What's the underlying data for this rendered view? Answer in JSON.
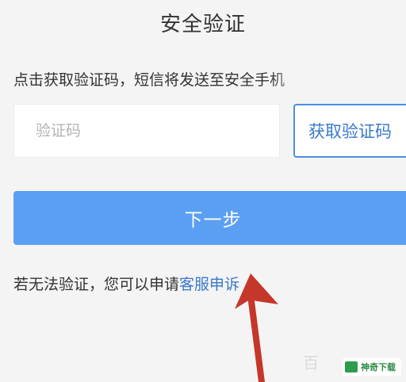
{
  "header": {
    "title": "安全验证"
  },
  "hint": {
    "text": "点击获取验证码，短信将发送至安全手机"
  },
  "form": {
    "code_placeholder": "验证码",
    "get_code_label": "获取验证码",
    "next_label": "下一步"
  },
  "footer": {
    "prefix": "若无法验证，您可以申请",
    "link_label": "客服申诉"
  },
  "watermark": {
    "ghost": "百",
    "text": "神奇下载"
  },
  "colors": {
    "primary": "#5b9ff2",
    "link": "#3a78cc",
    "arrow": "#c5372b",
    "background": "#f4f4f4"
  }
}
